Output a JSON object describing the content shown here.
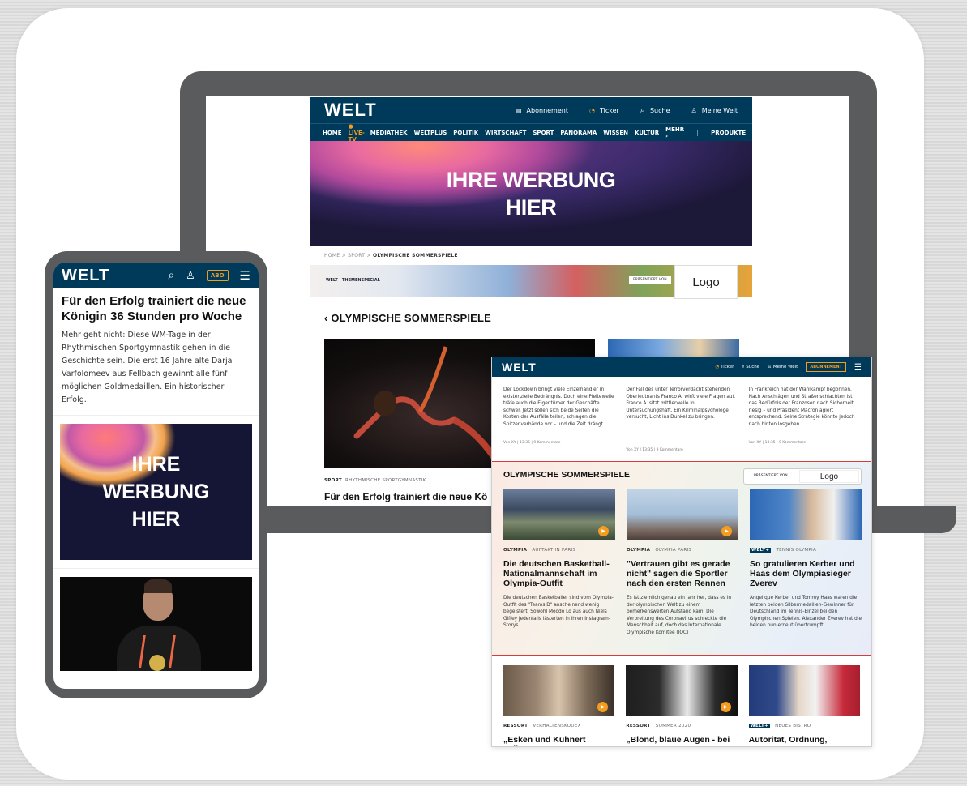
{
  "brand": {
    "logo": "WELT",
    "accent": "#f39c1f",
    "navy": "#003a5a"
  },
  "ad": {
    "line1": "IHRE WERBUNG",
    "line2": "HIER",
    "sq1": "IHRE",
    "sq2": "WERBUNG",
    "sq3": "HIER"
  },
  "desktop": {
    "top": {
      "abonnement": "Abonnement",
      "ticker": "Ticker",
      "suche": "Suche",
      "meine_welt": "Meine Welt"
    },
    "menu": [
      "HOME",
      "LIVE-TV",
      "MEDIATHEK",
      "WELTPLUS",
      "POLITIK",
      "WIRTSCHAFT",
      "SPORT",
      "PANORAMA",
      "WISSEN",
      "KULTUR",
      "MEHR",
      "PRODUKTE"
    ],
    "breadcrumb": {
      "home": "HOME",
      "sport": "SPORT",
      "current": "OLYMPISCHE SOMMERSPIELE",
      "sep": ">"
    },
    "themespecial": "WELT | THEMENSPECIAL",
    "praesentiert": "PRÄSENTIERT VON",
    "logo_placeholder": "Logo",
    "section_title": "OLYMPISCHE SOMMERSPIELE",
    "tag_sport": "SPORT",
    "tag_sub": "RHYTHMISCHE SPORTGYMNASTIK",
    "headline": "Für den Erfolg trainiert die neue Kö"
  },
  "phone": {
    "abo": "ABO",
    "headline": "Für den Erfolg trainiert die neue Königin 36 Stunden pro Woche",
    "body": "Mehr geht nicht: Diese WM-Tage in der Rhythmischen Sportgymnastik gehen in die Geschichte sein. Die erst 16 Jahre alte Darja Varfolomeev aus Fellbach gewinnt alle fünf möglichen Goldmedaillen. Ein historischer Erfolg."
  },
  "tablet": {
    "top": {
      "ticker": "Ticker",
      "suche": "Suche",
      "meine_welt": "Meine Welt",
      "abo": "ABONNEMENT"
    },
    "top_articles": [
      {
        "text": "Der Lockdown bringt viele Einzelhändler in existenzielle Bedrängnis. Doch eine Pleitewelle träfe auch die Eigentümer der Geschäfte schwer. Jetzt sollen sich beide Seiten die Kosten der Ausfälle teilen, schlagen die Spitzenverbände vor – und die Zeit drängt.",
        "meta": "Von XY | 13:35 | 9 Kommentare"
      },
      {
        "text": "Der Fall des unter Terrorverdacht stehenden Oberleutnants Franco A. wirft viele Fragen auf. Franco A. sitzt mittlerweile in Untersuchungshaft. Ein Kriminalpsychologe versucht, Licht ins Dunkel zu bringen.",
        "meta": "Von XY | 13:35 | 9 Kommentare"
      },
      {
        "text": "In Frankreich hat der Wahlkampf begonnen. Nach Anschlägen und Straßenschlachten ist das Bedürfnis der Franzosen nach Sicherheit riesig – und Präsident Macron agiert entsprechend. Seine Strategie könnte jedoch nach hinten losgehen.",
        "meta": "Von XY | 13:35 | 9 Kommentare"
      }
    ],
    "olympia_title": "OLYMPISCHE SOMMERSPIELE",
    "praesentiert": "PRÄSENTIERT VON",
    "logo_placeholder": "Logo",
    "olympia_articles": [
      {
        "tag": "OLYMPIA",
        "sub": "AUFTAKT IN PARIS",
        "headline": "Die deutschen Basketball-Nationalmannschaft im Olympia-Outfit",
        "text": "Die deutschen Basketballer sind vom Olympia-Outfit des \"Teams D\" anscheinend wenig begeistert. Sowohl Moodo Lo aus auch Niels Giffey jedenfalls lästerten in ihren Instagram-Storys"
      },
      {
        "tag": "OLYMPIA",
        "sub": "OLYMPIA PARIS",
        "headline": "\"Vertrauen gibt es gerade nicht\" sagen die Sportler nach den ersten Rennen",
        "text": "Es ist ziemlich genau ein Jahr her, dass es in der olympischen Welt zu einem bemerkenswerten Aufstand kam. Die Verbreitung des Coronavirus schreckte die Menschheit auf, doch das Internationale Olympische Komitee (IOC)"
      },
      {
        "tag": "WELT+",
        "sub": "TENNIS OLYMPIA",
        "headline": "So gratulieren Kerber und Haas dem Olympiasieger Zverev",
        "text": "Angelique Kerber und Tommy Haas waren die letzten beiden Silbermedaillen-Gewinner für Deutschland im Tennis-Einzel bei den Olympischen Spielen. Alexander Zverev hat die beiden nun erneut übertrumpft."
      }
    ],
    "bottom_articles": [
      {
        "tag": "RESSORT",
        "sub": "VERHALTENSKODEX",
        "headline": "„Esken und Kühnert sollten"
      },
      {
        "tag": "RESSORT",
        "sub": "SOMMER 2020",
        "headline": "„Blond, blaue Augen - bei"
      },
      {
        "tag": "WELT+",
        "sub": "NEUES BISTRO",
        "headline": "Autorität, Ordnung,"
      }
    ]
  }
}
